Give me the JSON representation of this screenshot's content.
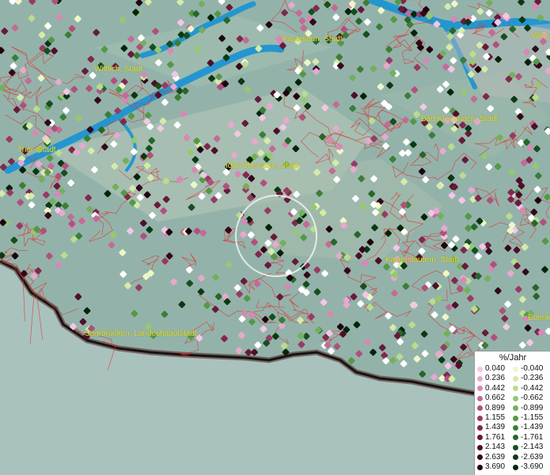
{
  "map": {
    "city_labels": [
      {
        "text": "Kastellaun, Stadt"
      },
      {
        "text": "Wittlich, Stadt"
      },
      {
        "text": "Bad Kreuznach, Stadt"
      },
      {
        "text": "Trier, Stadt"
      },
      {
        "text": "Idar-Oberstein, Stadt"
      },
      {
        "text": "Kaiserslautern, Stadt"
      },
      {
        "text": "Saarbrücken, Landeshauptstadt"
      },
      {
        "text": "Wies"
      },
      {
        "text": "Edenk"
      }
    ],
    "colors": {
      "terrain": "#8fb0a8",
      "river": "#1e90c8",
      "boundary": "#e03030",
      "border_line": "#1a1a1a",
      "label": "#e8e23a"
    }
  },
  "legend": {
    "title": "%/Jahr",
    "positive": [
      {
        "value": "0.040",
        "color": "#f4c6e6"
      },
      {
        "value": "0.236",
        "color": "#e8a8cf"
      },
      {
        "value": "0.442",
        "color": "#d888b4"
      },
      {
        "value": "0.662",
        "color": "#c46a98"
      },
      {
        "value": "0.899",
        "color": "#b0507d"
      },
      {
        "value": "1.155",
        "color": "#983a64"
      },
      {
        "value": "1.439",
        "color": "#80284e"
      },
      {
        "value": "1.761",
        "color": "#681a3a"
      },
      {
        "value": "2.143",
        "color": "#4e0f29"
      },
      {
        "value": "2.639",
        "color": "#35071b"
      },
      {
        "value": "3.690",
        "color": "#1f030f"
      }
    ],
    "negative": [
      {
        "value": "-0.040",
        "color": "#eef7c8"
      },
      {
        "value": "-0.236",
        "color": "#d6eba8"
      },
      {
        "value": "-0.442",
        "color": "#b9dd8c"
      },
      {
        "value": "-0.662",
        "color": "#96c870"
      },
      {
        "value": "-0.899",
        "color": "#74b05a"
      },
      {
        "value": "-1.155",
        "color": "#559848"
      },
      {
        "value": "-1.439",
        "color": "#3c7e38"
      },
      {
        "value": "-1.761",
        "color": "#28662a"
      },
      {
        "value": "-2.143",
        "color": "#184e1e"
      },
      {
        "value": "-2.639",
        "color": "#0c3814"
      },
      {
        "value": "-3.690",
        "color": "#04240a"
      }
    ]
  }
}
